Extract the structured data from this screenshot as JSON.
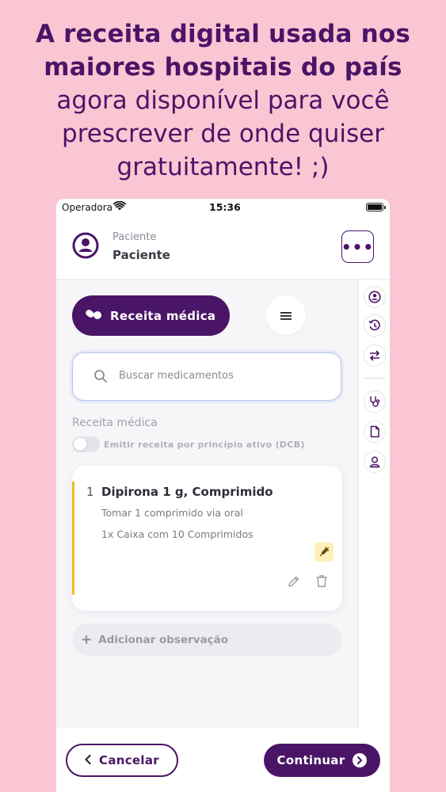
{
  "headline": {
    "line1": "A receita digital usada nos",
    "line2": "maiores hospitais do país",
    "line3": "agora disponível para você",
    "line4": "prescrever de onde quiser",
    "line5": "gratuitamente! ;)"
  },
  "statusbar": {
    "carrier": "Operadora",
    "time": "15:36"
  },
  "header": {
    "patient_label": "Paciente",
    "patient_name": "Paciente",
    "more_label": "•••"
  },
  "toolbar": {
    "rx_label": "Receita médica"
  },
  "search": {
    "placeholder": "Buscar medicamentos"
  },
  "section": {
    "label": "Receita médica",
    "toggle_label": "Emitir receita por princípio ativo (DCB)"
  },
  "medications": [
    {
      "number": "1",
      "name": "Dipirona 1 g, Comprimido",
      "dosage": "Tomar 1 comprimido via oral",
      "quantity": "1x Caixa com 10 Comprimidos"
    }
  ],
  "add_observation": {
    "label": "Adicionar observação"
  },
  "footer": {
    "cancel_label": "Cancelar",
    "continue_label": "Continuar"
  },
  "colors": {
    "brand": "#4a1566",
    "background": "#fbc6d3",
    "accent_bar": "#e8c21b"
  }
}
